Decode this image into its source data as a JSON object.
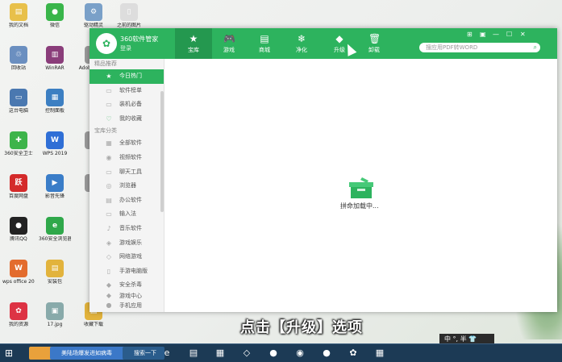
{
  "desktop_icons": [
    {
      "label": "我的文档",
      "color": "#e8c04a",
      "glyph": "▤"
    },
    {
      "label": "微信",
      "color": "#39b54a",
      "glyph": "●"
    },
    {
      "label": "驱动精灵",
      "color": "#7aa0c8",
      "glyph": "⚙"
    },
    {
      "label": "之前的图片",
      "color": "#ddd",
      "glyph": "▯"
    },
    {
      "label": "回收站",
      "color": "#6b8fc0",
      "glyph": "♲"
    },
    {
      "label": "WinRAR",
      "color": "#8a3d7a",
      "glyph": "▥"
    },
    {
      "label": "Adobe Flash",
      "color": "#999",
      "glyph": "A"
    },
    {
      "label": "这台电脑",
      "color": "#4a78b0",
      "glyph": "▭"
    },
    {
      "label": "控制面板",
      "color": "#3c7fc2",
      "glyph": "▦"
    },
    {
      "label": "360安全卫士",
      "color": "#3db44a",
      "glyph": "✚"
    },
    {
      "label": "WPS 2019",
      "color": "#2f6fd6",
      "glyph": "W"
    },
    {
      "label": "G",
      "color": "#999",
      "glyph": "G"
    },
    {
      "label": "百度网盘",
      "color": "#d42a2a",
      "glyph": "跃"
    },
    {
      "label": "影音先锋",
      "color": "#3a7dc8",
      "glyph": "▶"
    },
    {
      "label": "Q",
      "color": "#999",
      "glyph": "Q"
    },
    {
      "label": "腾讯QQ",
      "color": "#222",
      "glyph": "●"
    },
    {
      "label": "360安全浏览器",
      "color": "#2fa84a",
      "glyph": "e"
    },
    {
      "label": "wps office 2019 v11.1",
      "color": "#e36c2e",
      "glyph": "W"
    },
    {
      "label": "安装包",
      "color": "#e2b33c",
      "glyph": "▤"
    },
    {
      "label": "我的资源",
      "color": "#d34",
      "glyph": "✿"
    },
    {
      "label": "17.jpg",
      "color": "#8aa",
      "glyph": "▣"
    },
    {
      "label": "收藏下载",
      "color": "#e2b33c",
      "glyph": "▤"
    }
  ],
  "window": {
    "brand": "360软件管家",
    "login": "登录",
    "nav": [
      {
        "label": "宝库",
        "icon": "★",
        "active": true
      },
      {
        "label": "游戏",
        "icon": "🎮",
        "active": false
      },
      {
        "label": "商城",
        "icon": "▤",
        "active": false
      },
      {
        "label": "净化",
        "icon": "❄",
        "active": false
      },
      {
        "label": "升级",
        "icon": "◆",
        "active": false
      },
      {
        "label": "卸载",
        "icon": "🗑",
        "active": false
      }
    ],
    "search_placeholder": "搜应用PDF转WORD",
    "controls": [
      "⊞",
      "▣",
      "—",
      "☐",
      "✕"
    ],
    "sidebar": {
      "section1": "精品推荐",
      "items1": [
        {
          "label": "今日热门",
          "icon": "★",
          "active": true
        },
        {
          "label": "软件榜单",
          "icon": "▭"
        },
        {
          "label": "装机必备",
          "icon": "▭"
        },
        {
          "label": "我的收藏",
          "icon": "♡"
        }
      ],
      "section2": "宝库分类",
      "items2": [
        {
          "label": "全部软件",
          "icon": "▦"
        },
        {
          "label": "视频软件",
          "icon": "◉"
        },
        {
          "label": "聊天工具",
          "icon": "▭"
        },
        {
          "label": "浏览器",
          "icon": "◎"
        },
        {
          "label": "办公软件",
          "icon": "▤"
        },
        {
          "label": "输入法",
          "icon": "▭"
        },
        {
          "label": "音乐软件",
          "icon": "♪"
        },
        {
          "label": "游戏娱乐",
          "icon": "◈"
        },
        {
          "label": "网络游戏",
          "icon": "◇"
        },
        {
          "label": "手游电脑版",
          "icon": "▯"
        },
        {
          "label": "安全杀毒",
          "icon": "◆"
        }
      ],
      "foot": [
        {
          "label": "游戏中心",
          "icon": "◆"
        },
        {
          "label": "手机应用",
          "icon": "●"
        }
      ]
    },
    "loading_text": "拼命加载中..."
  },
  "subtitle": "点击【升级】选项",
  "taskbar": {
    "start_icon": "⊞",
    "items": [
      {
        "label": "",
        "color": "#e9a13b"
      },
      {
        "label": "美陆场爆发进如病毒",
        "color": "#3b78c8"
      },
      {
        "label": "搜索一下",
        "color": "#2a5c8c"
      }
    ],
    "apps": [
      "e",
      "▤",
      "▦",
      "◇",
      "●",
      "◉",
      "●",
      "✿",
      "▦"
    ],
    "ime": "中 °, 半 👕"
  }
}
